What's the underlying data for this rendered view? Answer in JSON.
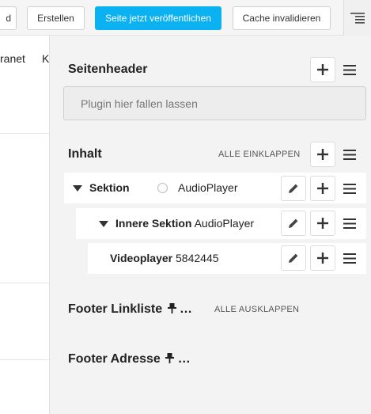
{
  "toolbar": {
    "partial_left_label": "d",
    "create_label": "Erstellen",
    "publish_label": "Seite jetzt veröffentlichen",
    "invalidate_cache_label": "Cache invalidieren"
  },
  "page": {
    "nav_fragment_1": "ranet",
    "nav_fragment_2": "K"
  },
  "panel": {
    "header_section": {
      "title": "Seitenheader",
      "dropzone_placeholder": "Plugin hier fallen lassen"
    },
    "content_section": {
      "title": "Inhalt",
      "collapse_all_label": "ALLE EINKLAPPEN",
      "rows": [
        {
          "name": "Sektion",
          "detail": "AudioPlayer"
        },
        {
          "name": "Innere Sektion",
          "detail": "AudioPlayer"
        },
        {
          "name": "Videoplayer",
          "detail": "5842445"
        }
      ]
    },
    "footer_links_section": {
      "title": "Footer Linkliste",
      "ellipsis": "…",
      "expand_all_label": "ALLE AUSKLAPPEN"
    },
    "footer_address_section": {
      "title": "Footer Adresse",
      "ellipsis": "…"
    }
  },
  "colors": {
    "primary": "#0bb1f0",
    "panel_bg": "#f3f3f3"
  },
  "icons": [
    "structure-toggle-icon",
    "plus-icon",
    "menu-icon",
    "pencil-icon",
    "caret-down-icon",
    "pin-icon"
  ]
}
